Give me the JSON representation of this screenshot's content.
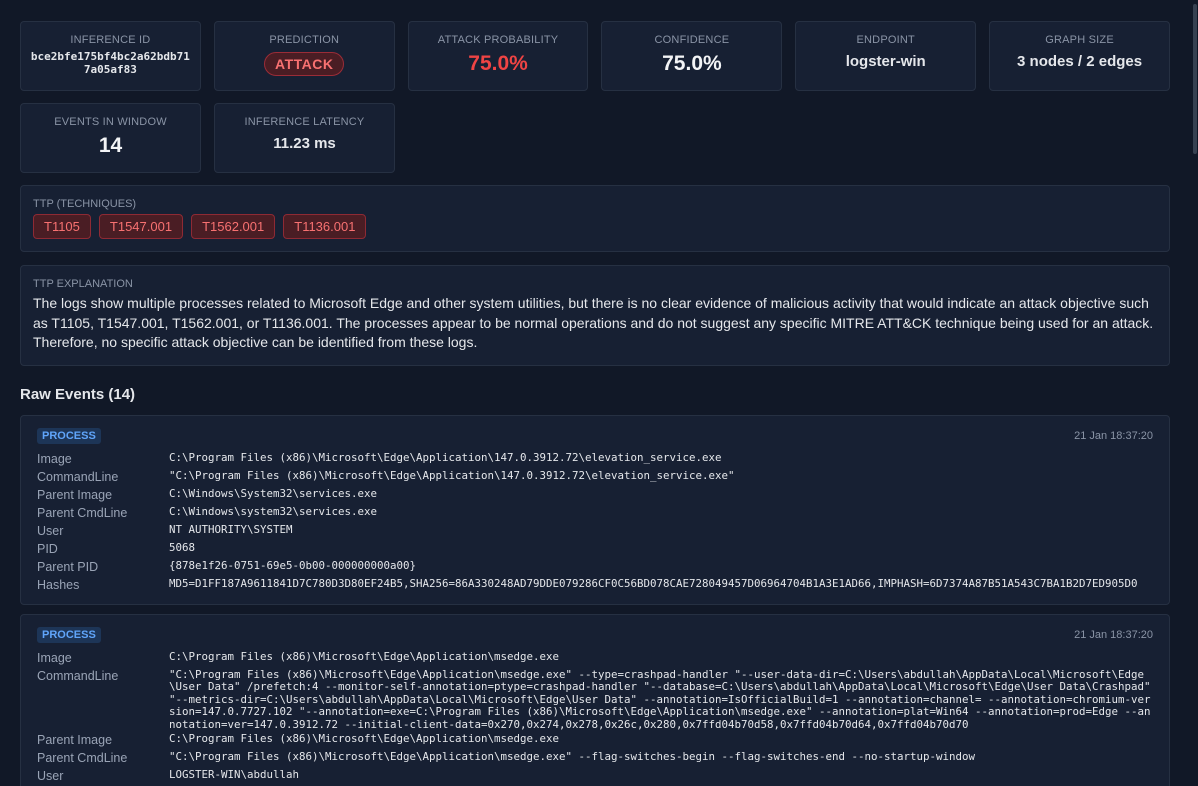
{
  "stats_row1": [
    {
      "label": "INFERENCE ID",
      "value": "bce2bfe175bf4bc2a62bdb717a05af83",
      "kind": "id"
    },
    {
      "label": "PREDICTION",
      "value": "ATTACK",
      "kind": "badge"
    },
    {
      "label": "ATTACK PROBABILITY",
      "value": "75.0%",
      "kind": "big-red"
    },
    {
      "label": "CONFIDENCE",
      "value": "75.0%",
      "kind": "big"
    },
    {
      "label": "ENDPOINT",
      "value": "logster-win",
      "kind": "med"
    },
    {
      "label": "GRAPH SIZE",
      "value": "3 nodes / 2 edges",
      "kind": "med"
    }
  ],
  "stats_row2": [
    {
      "label": "EVENTS IN WINDOW",
      "value": "14",
      "kind": "big"
    },
    {
      "label": "INFERENCE LATENCY",
      "value": "11.23 ms",
      "kind": "med"
    }
  ],
  "ttp": {
    "label": "TTP (TECHNIQUES)",
    "techniques": [
      "T1105",
      "T1547.001",
      "T1562.001",
      "T1136.001"
    ]
  },
  "explanation": {
    "label": "TTP EXPLANATION",
    "text": "The logs show multiple processes related to Microsoft Edge and other system utilities, but there is no clear evidence of malicious activity that would indicate an attack objective such as T1105, T1547.001, T1562.001, or T1136.001. The processes appear to be normal operations and do not suggest any specific MITRE ATT&CK technique being used for an attack. Therefore, no specific attack objective can be identified from these logs."
  },
  "raw_events": {
    "title": "Raw Events (14)",
    "events": [
      {
        "type": "PROCESS",
        "time": "21 Jan 18:37:20",
        "fields": [
          {
            "key": "Image",
            "value": "C:\\Program Files (x86)\\Microsoft\\Edge\\Application\\147.0.3912.72\\elevation_service.exe"
          },
          {
            "key": "CommandLine",
            "value": "\"C:\\Program Files (x86)\\Microsoft\\Edge\\Application\\147.0.3912.72\\elevation_service.exe\""
          },
          {
            "key": "Parent Image",
            "value": "C:\\Windows\\System32\\services.exe"
          },
          {
            "key": "Parent CmdLine",
            "value": "C:\\Windows\\system32\\services.exe"
          },
          {
            "key": "User",
            "value": "NT AUTHORITY\\SYSTEM"
          },
          {
            "key": "PID",
            "value": "5068"
          },
          {
            "key": "Parent PID",
            "value": "{878e1f26-0751-69e5-0b00-000000000a00}"
          },
          {
            "key": "Hashes",
            "value": "MD5=D1FF187A9611841D7C780D3D80EF24B5,SHA256=86A330248AD79DDE079286CF0C56BD078CAE728049457D06964704B1A3E1AD66,IMPHASH=6D7374A87B51A543C7BA1B2D7ED905D0"
          }
        ]
      },
      {
        "type": "PROCESS",
        "time": "21 Jan 18:37:20",
        "fields": [
          {
            "key": "Image",
            "value": "C:\\Program Files (x86)\\Microsoft\\Edge\\Application\\msedge.exe"
          },
          {
            "key": "CommandLine",
            "value": "\"C:\\Program Files (x86)\\Microsoft\\Edge\\Application\\msedge.exe\" --type=crashpad-handler \"--user-data-dir=C:\\Users\\abdullah\\AppData\\Local\\Microsoft\\Edge\\User Data\" /prefetch:4 --monitor-self-annotation=ptype=crashpad-handler \"--database=C:\\Users\\abdullah\\AppData\\Local\\Microsoft\\Edge\\User Data\\Crashpad\" \"--metrics-dir=C:\\Users\\abdullah\\AppData\\Local\\Microsoft\\Edge\\User Data\" --annotation=IsOfficialBuild=1 --annotation=channel= --annotation=chromium-version=147.0.7727.102 \"--annotation=exe=C:\\Program Files (x86)\\Microsoft\\Edge\\Application\\msedge.exe\" --annotation=plat=Win64 --annotation=prod=Edge --annotation=ver=147.0.3912.72 --initial-client-data=0x270,0x274,0x278,0x26c,0x280,0x7ffd04b70d58,0x7ffd04b70d64,0x7ffd04b70d70"
          },
          {
            "key": "Parent Image",
            "value": "C:\\Program Files (x86)\\Microsoft\\Edge\\Application\\msedge.exe"
          },
          {
            "key": "Parent CmdLine",
            "value": "\"C:\\Program Files (x86)\\Microsoft\\Edge\\Application\\msedge.exe\" --flag-switches-begin --flag-switches-end --no-startup-window"
          },
          {
            "key": "User",
            "value": "LOGSTER-WIN\\abdullah"
          }
        ]
      }
    ]
  }
}
